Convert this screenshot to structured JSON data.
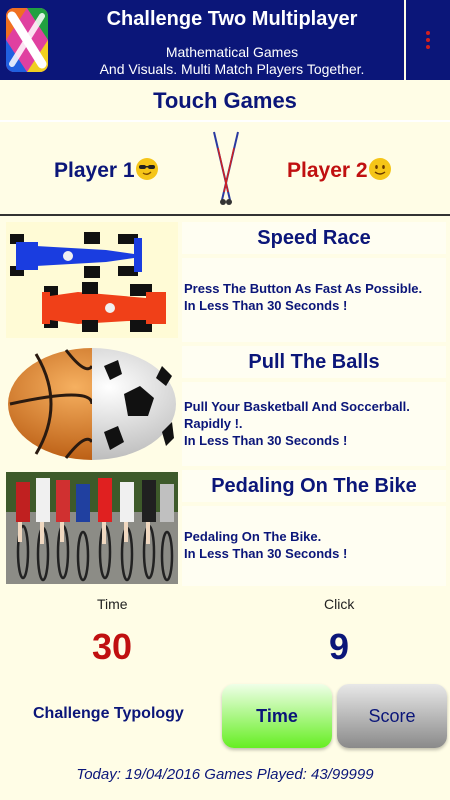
{
  "header": {
    "title": "Challenge Two Multiplayer",
    "subtitle_line1": "Mathematical Games",
    "subtitle_line2": "And Visuals. Multi Match Players Together.",
    "app_icon": "colored-x-logo-icon",
    "menu_icon": "overflow-menu-icon"
  },
  "section": {
    "title": "Touch Games"
  },
  "players": {
    "player1": "Player 1",
    "player2": "Player 2"
  },
  "games": [
    {
      "title": "Speed Race",
      "desc_line1": "Press The Button As Fast As Possible.",
      "desc_line2": "In Less Than 30 Seconds !",
      "image": "race-cars-image"
    },
    {
      "title": "Pull The Balls",
      "desc_line1": "Pull Your Basketball And Soccerball.",
      "desc_line2": "Rapidly !.",
      "desc_line3": "In Less Than 30 Seconds !",
      "image": "basketball-soccerball-image"
    },
    {
      "title": "Pedaling On The Bike",
      "desc_line1": "Pedaling On The Bike.",
      "desc_line2": "In Less Than 30 Seconds !",
      "image": "cyclists-image"
    }
  ],
  "stats": {
    "time_label": "Time",
    "time_value": "30",
    "click_label": "Click",
    "click_value": "9"
  },
  "controls": {
    "challenge_label": "Challenge Typology",
    "time_button": "Time",
    "score_button": "Score"
  },
  "footer": {
    "text": "Today: 19/04/2016 Games Played: 43/99999"
  },
  "colors": {
    "primary": "#0b1679",
    "accent_red": "#c01010",
    "background": "#fffde6",
    "time_button": "#66ee22"
  }
}
